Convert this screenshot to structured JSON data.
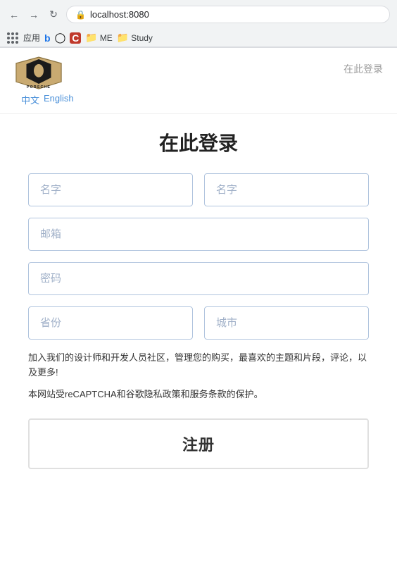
{
  "browser": {
    "url": "localhost:8080",
    "back_title": "←",
    "forward_title": "→",
    "refresh_title": "↻",
    "bookmarks": [
      {
        "label": "应用",
        "type": "apps"
      },
      {
        "label": "b",
        "type": "icon"
      },
      {
        "label": "○",
        "type": "icon"
      },
      {
        "label": "C",
        "type": "icon"
      },
      {
        "label": "ME",
        "type": "folder"
      },
      {
        "label": "Study",
        "type": "folder"
      }
    ]
  },
  "header": {
    "login_link": "在此登录",
    "lang_zh": "中文",
    "lang_en": "English"
  },
  "page": {
    "title": "在此登录",
    "first_name_placeholder": "名字",
    "last_name_placeholder": "名字",
    "email_placeholder": "邮箱",
    "password_placeholder": "密码",
    "province_placeholder": "省份",
    "city_placeholder": "城市",
    "info_text1": "加入我们的设计师和开发人员社区，管理您的购买，最喜欢的主题和片段，评论，以及更多!",
    "info_text2": "本网站受reCAPTCHA和谷歌隐私政策和服务条款的保护。",
    "register_btn": "注册"
  }
}
